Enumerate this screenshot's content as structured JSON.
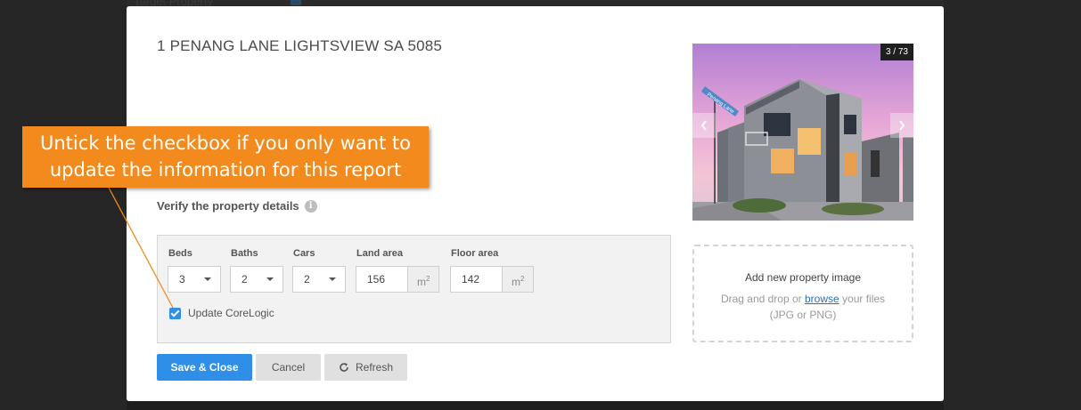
{
  "background": {
    "fragment_text": "Target Property"
  },
  "modal": {
    "title": "1 PENANG LANE LIGHTSVIEW SA 5085",
    "verify_label": "Verify the property details",
    "fields": {
      "beds": {
        "label": "Beds",
        "value": "3"
      },
      "baths": {
        "label": "Baths",
        "value": "2"
      },
      "cars": {
        "label": "Cars",
        "value": "2"
      },
      "land_area": {
        "label": "Land area",
        "value": "156",
        "unit": "m",
        "unit_sup": "2"
      },
      "floor_area": {
        "label": "Floor area",
        "value": "142",
        "unit": "m",
        "unit_sup": "2"
      }
    },
    "update_corelogic": {
      "label": "Update CoreLogic",
      "checked": true
    },
    "buttons": {
      "save": "Save & Close",
      "cancel": "Cancel",
      "refresh": "Refresh"
    },
    "photo": {
      "counter": "3 / 73",
      "street_sign": "Penang Lane"
    },
    "dropzone": {
      "title": "Add new property image",
      "line1_prefix": "Drag and drop or ",
      "browse_link": "browse",
      "line1_suffix": " your files",
      "line2": "(JPG or PNG)"
    }
  },
  "callout": {
    "line1": "Untick the checkbox if you only want to",
    "line2": "update the information for this report",
    "color": "#f28a1e"
  },
  "colors": {
    "accent": "#2f8ee8",
    "overlay": "#2b2b2b"
  }
}
